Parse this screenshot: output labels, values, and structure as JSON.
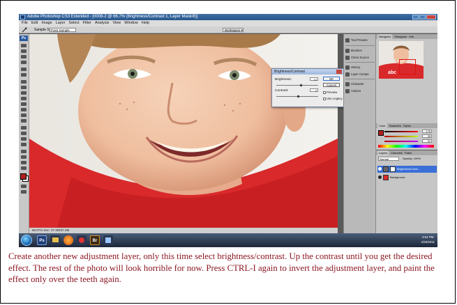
{
  "window": {
    "title": "Adobe Photoshop CS3 Extended - [0008-2 @ 66.7% (Brightness/Contrast 1, Layer Mask/8)]"
  },
  "menu": [
    "File",
    "Edit",
    "Image",
    "Layer",
    "Select",
    "Filter",
    "Analysis",
    "View",
    "Window",
    "Help"
  ],
  "options_bar": {
    "sample_size_label": "Sample Size:",
    "sample_size_value": "Point Sample",
    "workspace_label": "Workspace ▾"
  },
  "document": {
    "status": "66.67%   Doc: 37.3M/37.4M"
  },
  "brightness_contrast": {
    "title": "Brightness/Contrast",
    "brightness_label": "Brightness:",
    "brightness_value": "12",
    "contrast_label": "Contrast:",
    "contrast_value": "0",
    "ok_label": "OK",
    "cancel_label": "Cancel",
    "preview_label": "Preview",
    "legacy_label": "Use Legacy"
  },
  "dock": {
    "items": [
      "Tool Presets",
      "Brushes",
      "Clone Source",
      "History",
      "Layer Comps",
      "Character",
      "Actions"
    ]
  },
  "navigator": {
    "tabs": [
      "Navigator",
      "Histogram",
      "Info"
    ]
  },
  "color_panel": {
    "tabs": [
      "Color",
      "Swatches",
      "Styles"
    ],
    "r_value": "176",
    "g_value": "33",
    "b_value": "31"
  },
  "layers_panel": {
    "tabs": [
      "Layers",
      "Channels",
      "Paths"
    ],
    "blend_mode": "Normal",
    "opacity_label": "Opacity: 100%",
    "layers": [
      {
        "name": "Brightness/Contr..."
      },
      {
        "name": "Background"
      }
    ]
  },
  "taskbar": {
    "apps": [
      "Ps",
      "Br"
    ],
    "time": "4:54 PM",
    "date": "4/25/2011"
  },
  "caption": {
    "text": "Create another new adjustment layer, only this time select brightness/contrast.  Up the contrast until you get the desired effect.  The rest of the photo will look horrible for now.  Press CTRL-I again to invert the adjustment layer, and paint the effect only over the teeth again."
  },
  "colors": {
    "caption": "#8c1622",
    "shirt": "#d9292b",
    "skin": "#f1c2a4",
    "hair": "#a87a4a",
    "foreground_swatch": "#b0211f"
  },
  "icons": [
    "photoshop-icon",
    "eyedropper-icon",
    "start-orb-icon",
    "firefox-icon",
    "bridge-icon"
  ]
}
